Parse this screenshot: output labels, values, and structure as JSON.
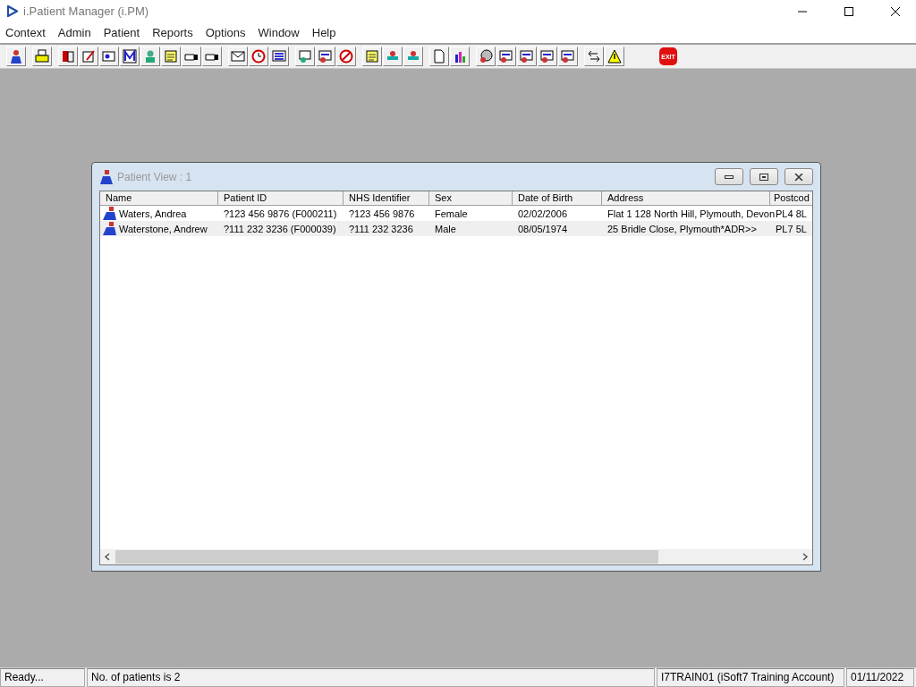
{
  "window": {
    "title": "i.Patient Manager (i.PM)"
  },
  "menu": [
    "Context",
    "Admin",
    "Patient",
    "Reports",
    "Options",
    "Window",
    "Help"
  ],
  "toolbar": {
    "exit_label": "EXIT"
  },
  "patient_view": {
    "title": "Patient View : 1",
    "columns": [
      "Name",
      "Patient ID",
      "NHS Identifier",
      "Sex",
      "Date of Birth",
      "Address",
      "Postcod"
    ],
    "rows": [
      {
        "cells": [
          "Waters, Andrea",
          "?123 456 9876 (F000211)",
          "?123 456 9876",
          "Female",
          "02/02/2006",
          "Flat 1 128 North Hill, Plymouth, Devon",
          "PL4 8L"
        ]
      },
      {
        "cells": [
          "Waterstone, Andrew",
          "?111 232 3236 (F000039)",
          "?111 232 3236",
          "Male",
          "08/05/1974",
          "25 Bridle Close, Plymouth*ADR>>",
          "PL7 5L"
        ]
      }
    ]
  },
  "status_bar": [
    "Ready...",
    "No. of patients is 2",
    "I7TRAIN01 (iSoft7 Training Account)",
    "01/11/2022"
  ]
}
